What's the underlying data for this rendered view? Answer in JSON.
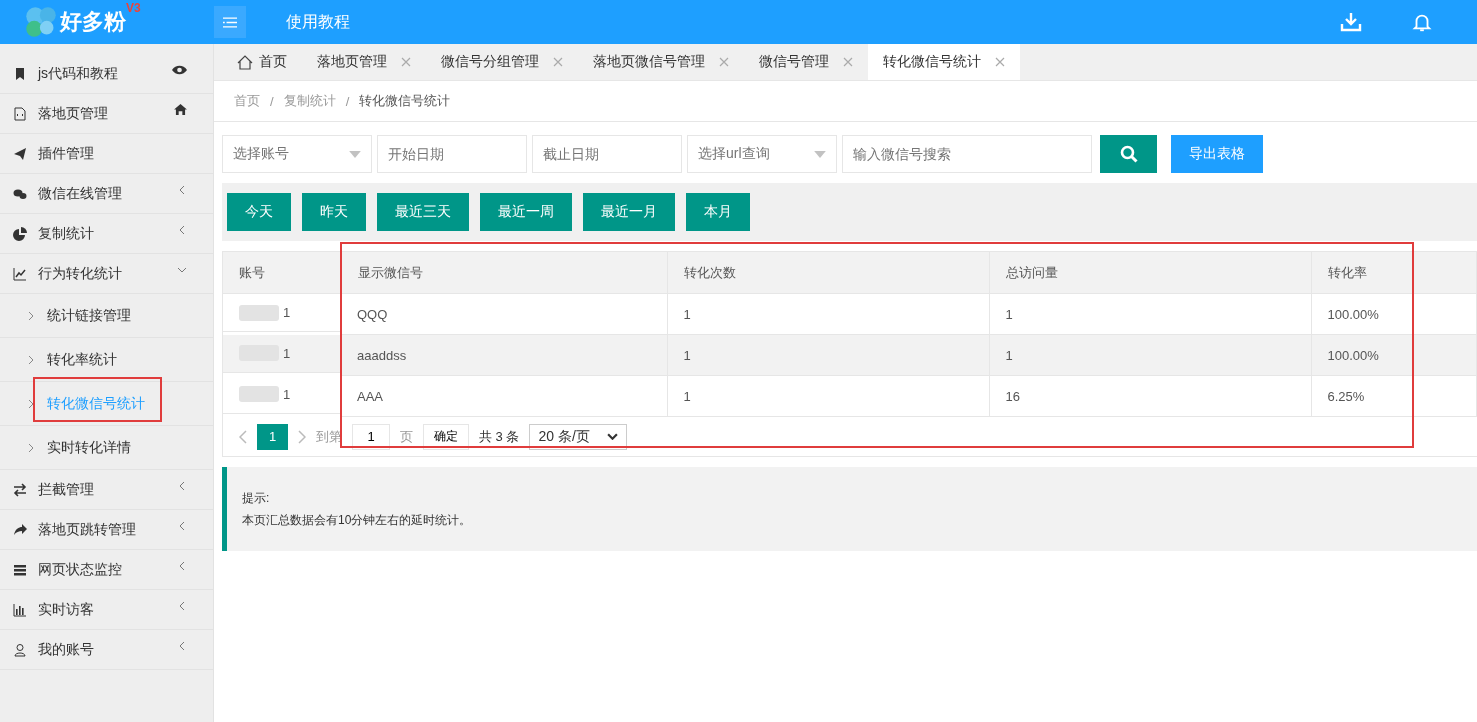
{
  "header": {
    "logo": "好多粉",
    "logo_badge": "V3",
    "nav_link": "使用教程"
  },
  "sidebar": {
    "items": [
      {
        "label": "js代码和教程"
      },
      {
        "label": "落地页管理"
      },
      {
        "label": "插件管理"
      },
      {
        "label": "微信在线管理",
        "expanded": false
      },
      {
        "label": "复制统计",
        "expanded": false
      },
      {
        "label": "行为转化统计",
        "expanded": true,
        "children": [
          {
            "label": "统计链接管理",
            "selected": false
          },
          {
            "label": "转化率统计",
            "selected": false
          },
          {
            "label": "转化微信号统计",
            "selected": true
          },
          {
            "label": "实时转化详情",
            "selected": false
          }
        ]
      },
      {
        "label": "拦截管理",
        "expanded": false
      },
      {
        "label": "落地页跳转管理",
        "expanded": false
      },
      {
        "label": "网页状态监控",
        "expanded": false
      },
      {
        "label": "实时访客",
        "expanded": false
      },
      {
        "label": "我的账号",
        "expanded": false
      }
    ]
  },
  "tabs": [
    {
      "kind": "home",
      "label": "首页",
      "selected": false
    },
    {
      "kind": "page",
      "label": "落地页管理",
      "selected": false
    },
    {
      "kind": "page",
      "label": "微信号分组管理",
      "selected": false
    },
    {
      "kind": "page",
      "label": "落地页微信号管理",
      "selected": false
    },
    {
      "kind": "page",
      "label": "微信号管理",
      "selected": false
    },
    {
      "kind": "page",
      "label": "转化微信号统计",
      "selected": true
    }
  ],
  "breadcrumb": {
    "separator": "/",
    "items": [
      "首页",
      "复制统计",
      "转化微信号统计"
    ]
  },
  "filters": [
    {
      "kind": "select",
      "placeholder": "选择账号"
    },
    {
      "kind": "input",
      "placeholder": "开始日期"
    },
    {
      "kind": "input",
      "placeholder": "截止日期"
    },
    {
      "kind": "select",
      "placeholder": "选择url查询"
    },
    {
      "kind": "search",
      "placeholder": "输入微信号搜索"
    }
  ],
  "export_button": "导出表格",
  "quick_ranges": [
    "今天",
    "昨天",
    "最近三天",
    "最近一周",
    "最近一月",
    "本月"
  ],
  "table": {
    "columns": [
      "账号",
      "显示微信号",
      "转化次数",
      "总访问量",
      "转化率"
    ],
    "rows": [
      [
        "1",
        "QQQ",
        "1",
        "1",
        "100.00%"
      ],
      [
        "1",
        "aaaddss",
        "1",
        "1",
        "100.00%"
      ],
      [
        "1",
        "AAA",
        "1",
        "16",
        "6.25%"
      ]
    ]
  },
  "pagination": {
    "pages": [
      {
        "label": "1",
        "selected": true
      }
    ],
    "goto_prefix": "到第",
    "goto_value": "1",
    "goto_suffix": "页",
    "confirm": "确定",
    "total": "共 3 条",
    "page_size": "20 条/页"
  },
  "tip": {
    "title": "提示:",
    "text": "本页汇总数据会有10分钟左右的延时统计。"
  }
}
